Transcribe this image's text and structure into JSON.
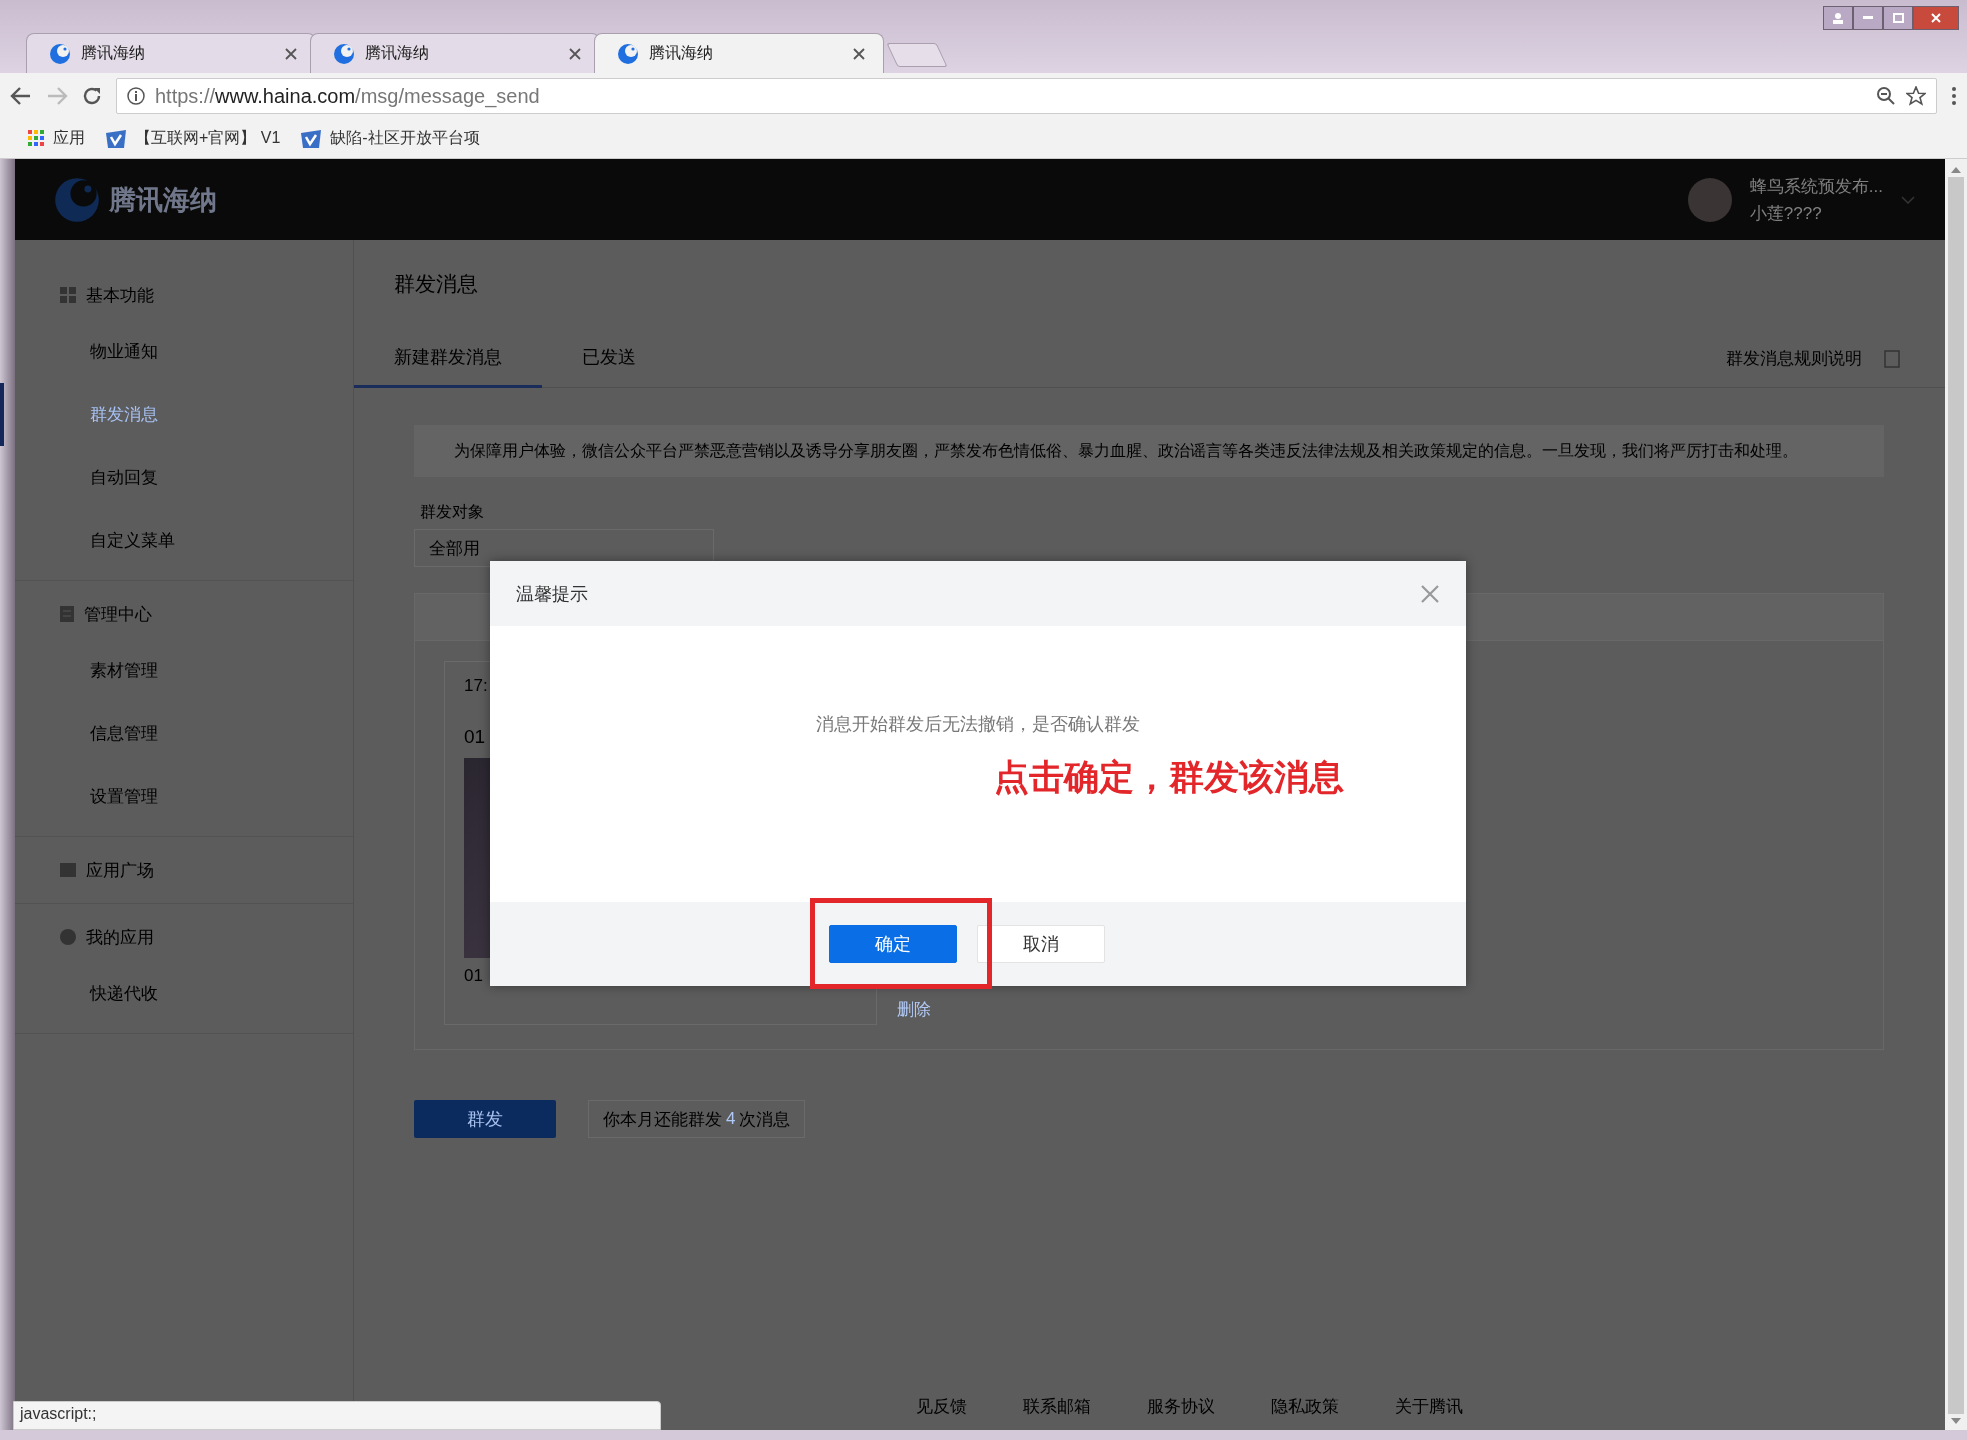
{
  "browser": {
    "tabs": [
      {
        "title": "腾讯海纳",
        "selected": false
      },
      {
        "title": "腾讯海纳",
        "selected": false
      },
      {
        "title": "腾讯海纳",
        "selected": true
      }
    ],
    "url": {
      "scheme": "https://",
      "host": "www.haina.com",
      "path": "/msg/message_send"
    },
    "bookmarks": [
      {
        "label": "应用",
        "kind": "apps"
      },
      {
        "label": "【互联网+官网】 V1",
        "kind": "site"
      },
      {
        "label": "缺陷-社区开放平台项",
        "kind": "site"
      }
    ],
    "status_text": "javascript:;"
  },
  "header": {
    "brand": "腾讯海纳",
    "account_name": "蜂鸟系统预发布...",
    "user_name": "小莲????"
  },
  "sidebar": {
    "groups": [
      {
        "title": "基本功能",
        "items": [
          {
            "label": "物业通知",
            "selected": false
          },
          {
            "label": "群发消息",
            "selected": true
          },
          {
            "label": "自动回复",
            "selected": false
          },
          {
            "label": "自定义菜单",
            "selected": false
          }
        ]
      },
      {
        "title": "管理中心",
        "items": [
          {
            "label": "素材管理",
            "selected": false
          },
          {
            "label": "信息管理",
            "selected": false
          },
          {
            "label": "设置管理",
            "selected": false
          }
        ]
      },
      {
        "title": "应用广场"
      },
      {
        "title": "我的应用",
        "items": [
          {
            "label": "快递代收",
            "selected": false
          }
        ]
      }
    ]
  },
  "page": {
    "title": "群发消息",
    "tabs": [
      {
        "label": "新建群发消息",
        "selected": true
      },
      {
        "label": "已发送",
        "selected": false
      }
    ],
    "rules_link": "群发消息规则说明",
    "notice": "为保障用户体验，微信公众平台严禁恶意营销以及诱导分享朋友圈，严禁发布色情低俗、暴力血腥、政治谣言等各类违反法律法规及相关政策规定的信息。一旦发现，我们将严厉打击和处理。",
    "target_label": "群发对象",
    "target_value": "全部用",
    "message": {
      "time": "17:",
      "title": "01",
      "caption": "01",
      "delete_link": "删除"
    },
    "send_button": "群发",
    "quota": {
      "before": "你本月还能群发",
      "count": "4",
      "after": "次消息"
    },
    "footer_links": [
      "见反馈",
      "联系邮箱",
      "服务协议",
      "隐私政策",
      "关于腾讯"
    ]
  },
  "dialog": {
    "title": "温馨提示",
    "message": "消息开始群发后无法撤销，是否确认群发",
    "buttons": [
      {
        "label": "确定",
        "kind": "primary"
      },
      {
        "label": "取消",
        "kind": "secondary"
      }
    ]
  },
  "annotation": {
    "text": "点击确定，群发该消息"
  }
}
